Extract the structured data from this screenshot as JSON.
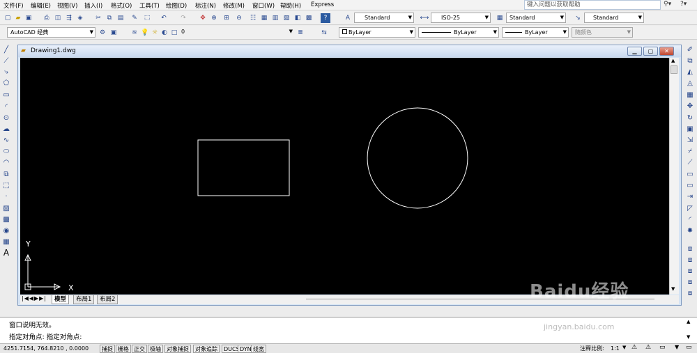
{
  "menu": [
    "文件(F)",
    "编辑(E)",
    "视图(V)",
    "插入(I)",
    "格式(O)",
    "工具(T)",
    "绘图(D)",
    "标注(N)",
    "修改(M)",
    "窗口(W)",
    "帮助(H)",
    "Express"
  ],
  "help_placeholder": "键入问题以获取帮助",
  "styles": {
    "text_style": "Standard",
    "dim_style": "ISO-25",
    "table_style": "Standard",
    "multileader_style": "Standard"
  },
  "workspace": "AutoCAD 经典",
  "layer": "0",
  "properties": {
    "color": "ByLayer",
    "linetype": "ByLayer",
    "lineweight": "ByLayer",
    "plotstyle": "随颜色"
  },
  "drawing": {
    "title": "Drawing1.dwg",
    "ucs_y": "Y",
    "ucs_x": "X",
    "tabs": [
      "模型",
      "布局1",
      "布局2"
    ]
  },
  "command": {
    "line1": "窗口说明无效。",
    "line2": "指定对角点: 指定对角点:"
  },
  "status": {
    "coords": "4251.7154, 764.8210 , 0.0000",
    "buttons": [
      "捕捉",
      "栅格",
      "正交",
      "极轴",
      "对象捕捉",
      "对象追踪",
      "DUCS",
      "DYN",
      "线宽"
    ],
    "annotation_scale_label": "注释比例:",
    "annotation_scale": "1:1"
  },
  "watermark": {
    "logo": "Baidu经验",
    "url": "jingyan.baidu.com"
  },
  "colors": {
    "canvas": "#000000",
    "shapes": "#ffffff"
  }
}
